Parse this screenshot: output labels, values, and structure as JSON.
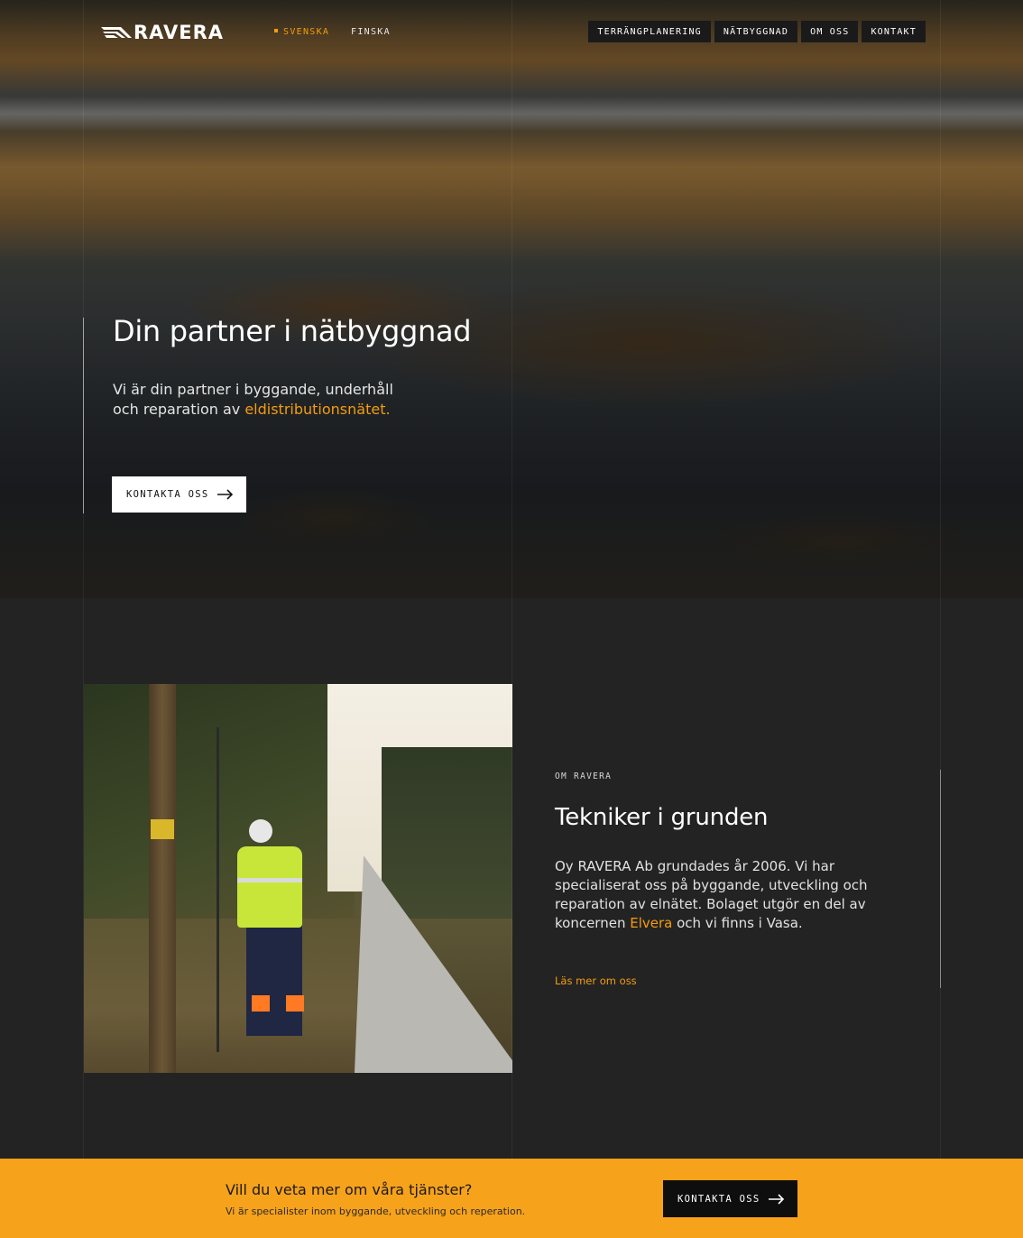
{
  "header": {
    "logo_text": "RAVERA",
    "languages": [
      {
        "label": "SVENSKA",
        "active": true
      },
      {
        "label": "FINSKA",
        "active": false
      }
    ],
    "nav": [
      "TERRÄNGPLANERING",
      "NÄTBYGGNAD",
      "OM OSS",
      "KONTAKT"
    ]
  },
  "hero": {
    "title": "Din partner i nätbyggnad",
    "subtitle_pre": "Vi är din partner i byggande, underhåll och reparation av ",
    "subtitle_highlight": "eldistributionsnätet.",
    "button_label": "KONTAKTA OSS"
  },
  "about": {
    "kicker": "OM RAVERA",
    "title": "Tekniker i grunden",
    "body_pre": "Oy RAVERA Ab grundades år 2006. Vi har specialiserat oss på byggande, utveckling och reparation av elnätet. Bolaget utgör en del av koncernen ",
    "body_highlight": "Elvera",
    "body_post": " och vi finns i Vasa.",
    "link_label": "Läs mer om oss"
  },
  "cta": {
    "title": "Vill du veta mer om våra tjänster?",
    "subtitle": "Vi är specialister inom byggande, utveckling och reperation.",
    "button_label": "KONTAKTA OSS"
  },
  "colors": {
    "accent": "#f39c12",
    "cta_background": "#f7a21b",
    "dark_background": "#232323"
  },
  "icons": {
    "logo": "ravera-wing-logo-icon",
    "arrow": "arrow-right-icon"
  }
}
